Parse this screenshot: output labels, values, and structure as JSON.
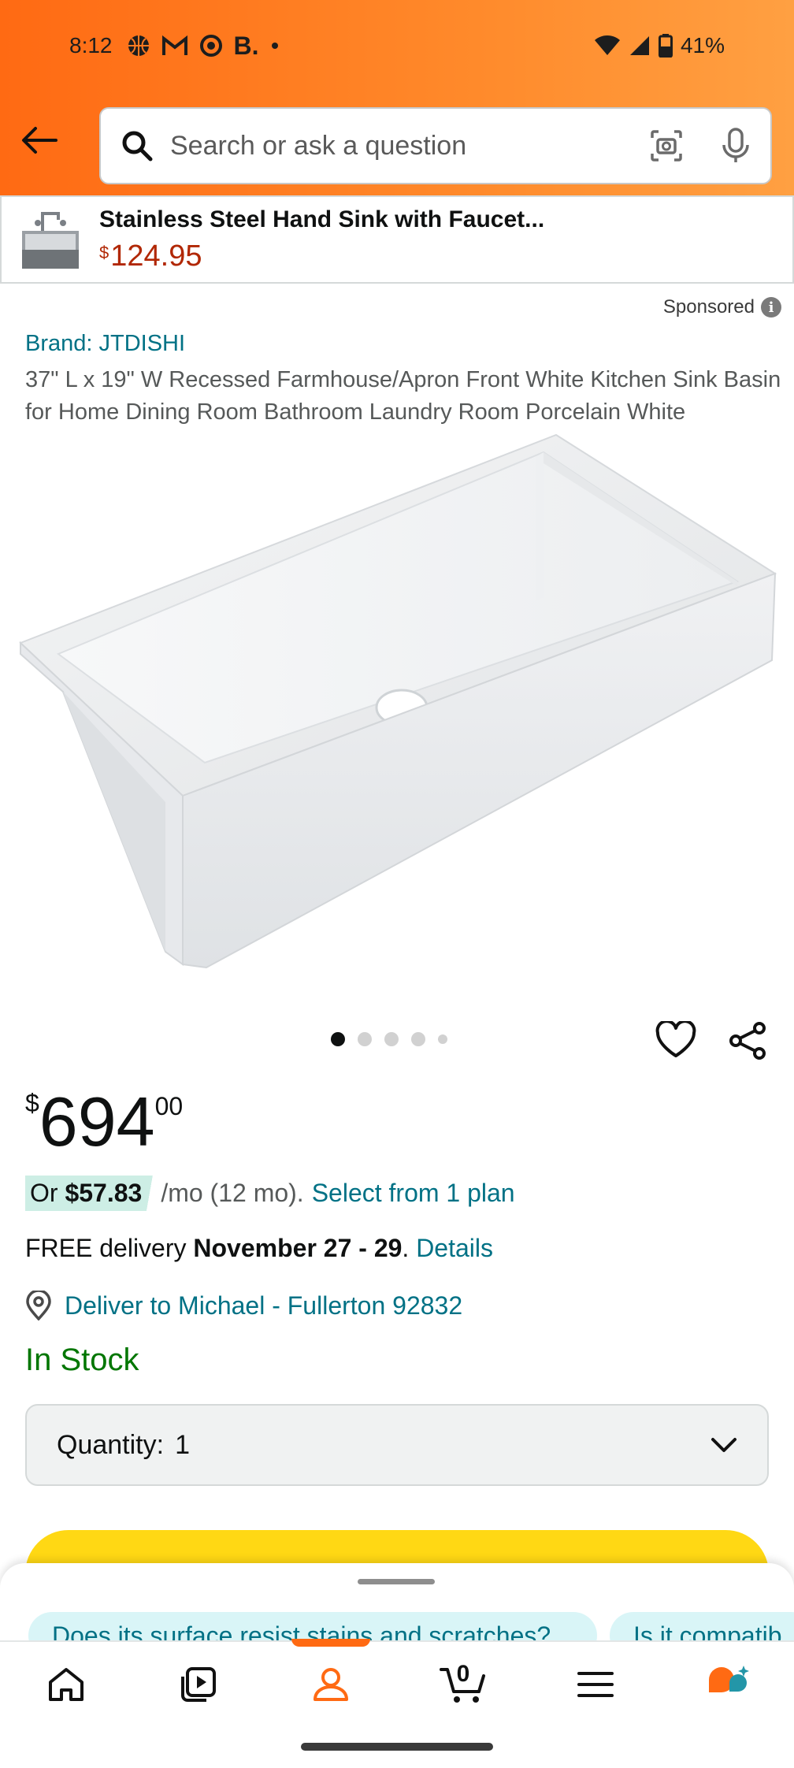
{
  "status_bar": {
    "time": "8:12",
    "battery": "41%",
    "icons": [
      "basketball-icon",
      "gmail-icon",
      "record-icon",
      "booking-icon",
      "dot-icon"
    ]
  },
  "search": {
    "placeholder": "Search or ask a question"
  },
  "sponsored_banner": {
    "title": "Stainless Steel Hand Sink with Faucet...",
    "currency": "$",
    "price": "124.95"
  },
  "sponsored_label": "Sponsored",
  "info_glyph": "i",
  "product": {
    "brand": "Brand: JTDISHI",
    "title": "37\" L x 19\" W Recessed Farmhouse/Apron Front White Kitchen Sink Basin for Home Dining Room Bathroom Laundry Room Porcelain White",
    "image_count": 5,
    "active_image": 1,
    "price_symbol": "$",
    "price_whole": "694",
    "price_fraction": "00",
    "plan": {
      "prefix": "Or ",
      "amount": "$57.83",
      "per": "/mo (12 mo).",
      "link": "Select from 1 plan"
    },
    "delivery": {
      "prefix": "FREE delivery ",
      "dates": "November 27 - 29",
      "separator": ". ",
      "link": "Details"
    },
    "deliver_to": "Deliver to Michael - Fullerton 92832",
    "stock": "In Stock",
    "quantity": {
      "label": "Quantity:",
      "value": "1"
    }
  },
  "sheet": {
    "chips": [
      "Does its surface resist stains and scratches?",
      "Is it compatib"
    ]
  },
  "nav": {
    "cart_count": "0",
    "items": [
      "home-icon",
      "video-icon",
      "account-icon",
      "cart-icon",
      "menu-icon",
      "rufus-icon"
    ],
    "active": "account"
  },
  "colors": {
    "header_orange": "#ff6a13",
    "price_red": "#b12704",
    "link_teal": "#007185",
    "in_stock_green": "#007600",
    "cart_button_yellow": "#ffd814"
  }
}
